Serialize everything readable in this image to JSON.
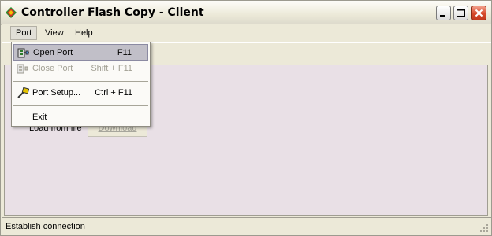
{
  "window": {
    "title": "Controller Flash Copy - Client"
  },
  "menubar": {
    "items": [
      {
        "label": "Port"
      },
      {
        "label": "View"
      },
      {
        "label": "Help"
      }
    ]
  },
  "port_menu": {
    "items": [
      {
        "label": "Open Port",
        "shortcut": "F11",
        "icon": "connect-icon",
        "state": "highlighted"
      },
      {
        "label": "Close Port",
        "shortcut": "Shift + F11",
        "icon": "disconnect-icon",
        "state": "disabled"
      },
      {
        "label": "Port Setup...",
        "shortcut": "Ctrl + F11",
        "icon": "setup-icon",
        "state": "enabled"
      },
      {
        "label": "Exit",
        "shortcut": "",
        "icon": "",
        "state": "enabled"
      }
    ]
  },
  "main": {
    "load_label": "Load from file",
    "download_label": "Download",
    "download_enabled": false
  },
  "statusbar": {
    "text": "Establish connection"
  },
  "colors": {
    "client_bg": "#e9e0e6",
    "highlight": "#c1bfc8",
    "close_button": "#d6492a"
  }
}
